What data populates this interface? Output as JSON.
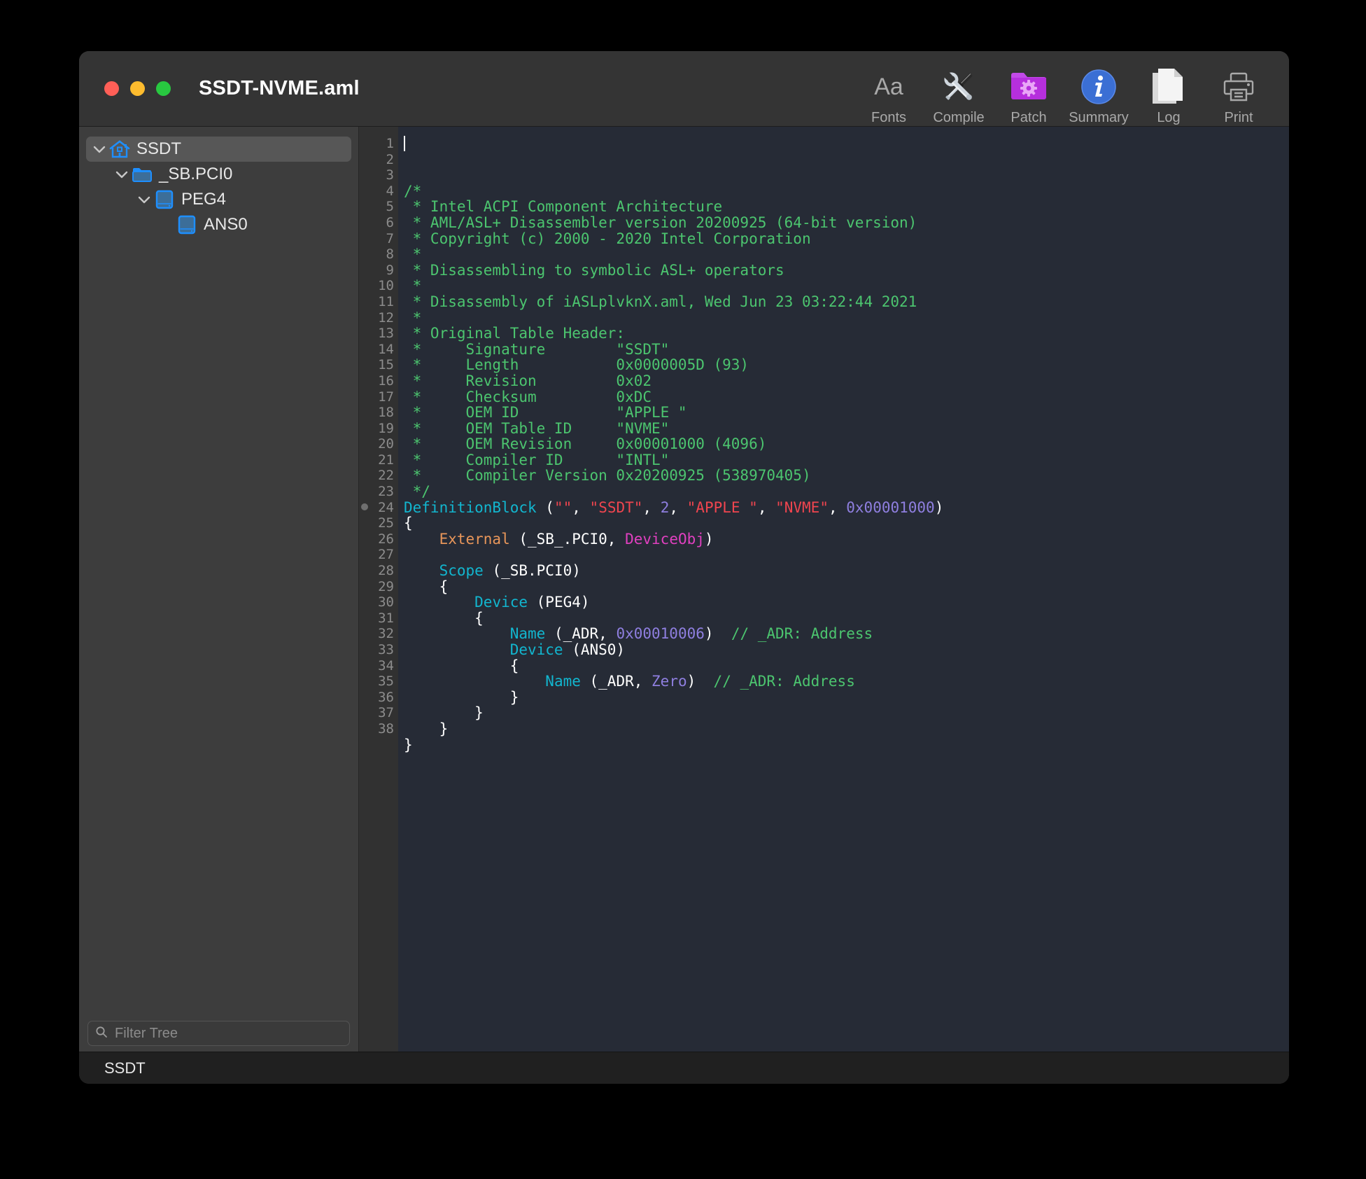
{
  "window": {
    "title": "SSDT-NVME.aml",
    "traffic_lights": [
      "close",
      "minimize",
      "zoom"
    ]
  },
  "toolbar": {
    "items": [
      {
        "label": "Fonts",
        "icon": "text-format-icon"
      },
      {
        "label": "Compile",
        "icon": "tools-icon"
      },
      {
        "label": "Patch",
        "icon": "purple-folder-gear-icon"
      },
      {
        "label": "Summary",
        "icon": "info-circle-icon"
      },
      {
        "label": "Log",
        "icon": "document-pages-icon"
      },
      {
        "label": "Print",
        "icon": "printer-icon"
      }
    ]
  },
  "sidebar": {
    "tree": [
      {
        "label": "SSDT",
        "icon": "home-icon",
        "depth": 0,
        "expanded": true,
        "selected": true,
        "has_twisty": true
      },
      {
        "label": "_SB.PCI0",
        "icon": "folder-icon",
        "depth": 1,
        "expanded": true,
        "selected": false,
        "has_twisty": true
      },
      {
        "label": "PEG4",
        "icon": "device-icon",
        "depth": 2,
        "expanded": true,
        "selected": false,
        "has_twisty": true
      },
      {
        "label": "ANS0",
        "icon": "device-icon",
        "depth": 3,
        "expanded": false,
        "selected": false,
        "has_twisty": false
      }
    ],
    "filter": {
      "placeholder": "Filter Tree",
      "value": "",
      "icon": "search-icon"
    }
  },
  "statusbar": {
    "text": "SSDT"
  },
  "editor": {
    "first_line": 1,
    "last_line": 38,
    "fold_marker_line": 24,
    "caret_line": 1,
    "lines": [
      {
        "n": 1,
        "tokens": [
          {
            "t": "/*",
            "c": "cm"
          }
        ]
      },
      {
        "n": 2,
        "tokens": [
          {
            "t": " * Intel ACPI Component Architecture",
            "c": "cm"
          }
        ]
      },
      {
        "n": 3,
        "tokens": [
          {
            "t": " * AML/ASL+ Disassembler version 20200925 (64-bit version)",
            "c": "cm"
          }
        ]
      },
      {
        "n": 4,
        "tokens": [
          {
            "t": " * Copyright (c) 2000 - 2020 Intel Corporation",
            "c": "cm"
          }
        ]
      },
      {
        "n": 5,
        "tokens": [
          {
            "t": " *",
            "c": "cm"
          }
        ]
      },
      {
        "n": 6,
        "tokens": [
          {
            "t": " * Disassembling to symbolic ASL+ operators",
            "c": "cm"
          }
        ]
      },
      {
        "n": 7,
        "tokens": [
          {
            "t": " *",
            "c": "cm"
          }
        ]
      },
      {
        "n": 8,
        "tokens": [
          {
            "t": " * Disassembly of iASLplvknX.aml, Wed Jun 23 03:22:44 2021",
            "c": "cm"
          }
        ]
      },
      {
        "n": 9,
        "tokens": [
          {
            "t": " *",
            "c": "cm"
          }
        ]
      },
      {
        "n": 10,
        "tokens": [
          {
            "t": " * Original Table Header:",
            "c": "cm"
          }
        ]
      },
      {
        "n": 11,
        "tokens": [
          {
            "t": " *     Signature        \"SSDT\"",
            "c": "cm"
          }
        ]
      },
      {
        "n": 12,
        "tokens": [
          {
            "t": " *     Length           0x0000005D (93)",
            "c": "cm"
          }
        ]
      },
      {
        "n": 13,
        "tokens": [
          {
            "t": " *     Revision         0x02",
            "c": "cm"
          }
        ]
      },
      {
        "n": 14,
        "tokens": [
          {
            "t": " *     Checksum         0xDC",
            "c": "cm"
          }
        ]
      },
      {
        "n": 15,
        "tokens": [
          {
            "t": " *     OEM ID           \"APPLE \"",
            "c": "cm"
          }
        ]
      },
      {
        "n": 16,
        "tokens": [
          {
            "t": " *     OEM Table ID     \"NVME\"",
            "c": "cm"
          }
        ]
      },
      {
        "n": 17,
        "tokens": [
          {
            "t": " *     OEM Revision     0x00001000 (4096)",
            "c": "cm"
          }
        ]
      },
      {
        "n": 18,
        "tokens": [
          {
            "t": " *     Compiler ID      \"INTL\"",
            "c": "cm"
          }
        ]
      },
      {
        "n": 19,
        "tokens": [
          {
            "t": " *     Compiler Version 0x20200925 (538970405)",
            "c": "cm"
          }
        ]
      },
      {
        "n": 20,
        "tokens": [
          {
            "t": " */",
            "c": "cm"
          }
        ]
      },
      {
        "n": 21,
        "tokens": [
          {
            "t": "DefinitionBlock",
            "c": "kw"
          },
          {
            "t": " (",
            "c": "pl"
          },
          {
            "t": "\"\"",
            "c": "str"
          },
          {
            "t": ", ",
            "c": "pl"
          },
          {
            "t": "\"SSDT\"",
            "c": "str"
          },
          {
            "t": ", ",
            "c": "pl"
          },
          {
            "t": "2",
            "c": "num"
          },
          {
            "t": ", ",
            "c": "pl"
          },
          {
            "t": "\"APPLE \"",
            "c": "str"
          },
          {
            "t": ", ",
            "c": "pl"
          },
          {
            "t": "\"NVME\"",
            "c": "str"
          },
          {
            "t": ", ",
            "c": "pl"
          },
          {
            "t": "0x00001000",
            "c": "num"
          },
          {
            "t": ")",
            "c": "pl"
          }
        ]
      },
      {
        "n": 22,
        "tokens": [
          {
            "t": "{",
            "c": "pl"
          }
        ]
      },
      {
        "n": 23,
        "tokens": [
          {
            "t": "    ",
            "c": "pl"
          },
          {
            "t": "External",
            "c": "kw2"
          },
          {
            "t": " (_SB_.PCI0, ",
            "c": "pl"
          },
          {
            "t": "DeviceObj",
            "c": "mag"
          },
          {
            "t": ")",
            "c": "pl"
          }
        ]
      },
      {
        "n": 24,
        "tokens": [
          {
            "t": "",
            "c": "pl"
          }
        ]
      },
      {
        "n": 25,
        "tokens": [
          {
            "t": "    ",
            "c": "pl"
          },
          {
            "t": "Scope",
            "c": "kw"
          },
          {
            "t": " (_SB.PCI0)",
            "c": "pl"
          }
        ]
      },
      {
        "n": 26,
        "tokens": [
          {
            "t": "    {",
            "c": "pl"
          }
        ]
      },
      {
        "n": 27,
        "tokens": [
          {
            "t": "        ",
            "c": "pl"
          },
          {
            "t": "Device",
            "c": "kw"
          },
          {
            "t": " (PEG4)",
            "c": "pl"
          }
        ]
      },
      {
        "n": 28,
        "tokens": [
          {
            "t": "        {",
            "c": "pl"
          }
        ]
      },
      {
        "n": 29,
        "tokens": [
          {
            "t": "            ",
            "c": "pl"
          },
          {
            "t": "Name",
            "c": "kw"
          },
          {
            "t": " (_ADR, ",
            "c": "pl"
          },
          {
            "t": "0x00010006",
            "c": "num"
          },
          {
            "t": ")  ",
            "c": "pl"
          },
          {
            "t": "// _ADR: Address",
            "c": "cm"
          }
        ]
      },
      {
        "n": 30,
        "tokens": [
          {
            "t": "            ",
            "c": "pl"
          },
          {
            "t": "Device",
            "c": "kw"
          },
          {
            "t": " (ANS0)",
            "c": "pl"
          }
        ]
      },
      {
        "n": 31,
        "tokens": [
          {
            "t": "            {",
            "c": "pl"
          }
        ]
      },
      {
        "n": 32,
        "tokens": [
          {
            "t": "                ",
            "c": "pl"
          },
          {
            "t": "Name",
            "c": "kw"
          },
          {
            "t": " (_ADR, ",
            "c": "pl"
          },
          {
            "t": "Zero",
            "c": "num"
          },
          {
            "t": ")  ",
            "c": "pl"
          },
          {
            "t": "// _ADR: Address",
            "c": "cm"
          }
        ]
      },
      {
        "n": 33,
        "tokens": [
          {
            "t": "            }",
            "c": "pl"
          }
        ]
      },
      {
        "n": 34,
        "tokens": [
          {
            "t": "        }",
            "c": "pl"
          }
        ]
      },
      {
        "n": 35,
        "tokens": [
          {
            "t": "    }",
            "c": "pl"
          }
        ]
      },
      {
        "n": 36,
        "tokens": [
          {
            "t": "}",
            "c": "pl"
          }
        ]
      },
      {
        "n": 37,
        "tokens": [
          {
            "t": "",
            "c": "pl"
          }
        ]
      },
      {
        "n": 38,
        "tokens": [
          {
            "t": "",
            "c": "pl"
          }
        ]
      }
    ]
  },
  "colors": {
    "window_chrome": "#343434",
    "sidebar_bg": "#3d3d3d",
    "editor_bg": "#262b36",
    "gutter_bg": "#313131",
    "comment": "#4cc56f",
    "keyword": "#12b6cf",
    "keyword_alt": "#e8965a",
    "string": "#f0454f",
    "number": "#8f7fe0",
    "magenta": "#e040c0",
    "tree_icon_blue": "#1e8fff",
    "patch_purple": "#b83ee0",
    "info_blue": "#3b6fd4"
  }
}
